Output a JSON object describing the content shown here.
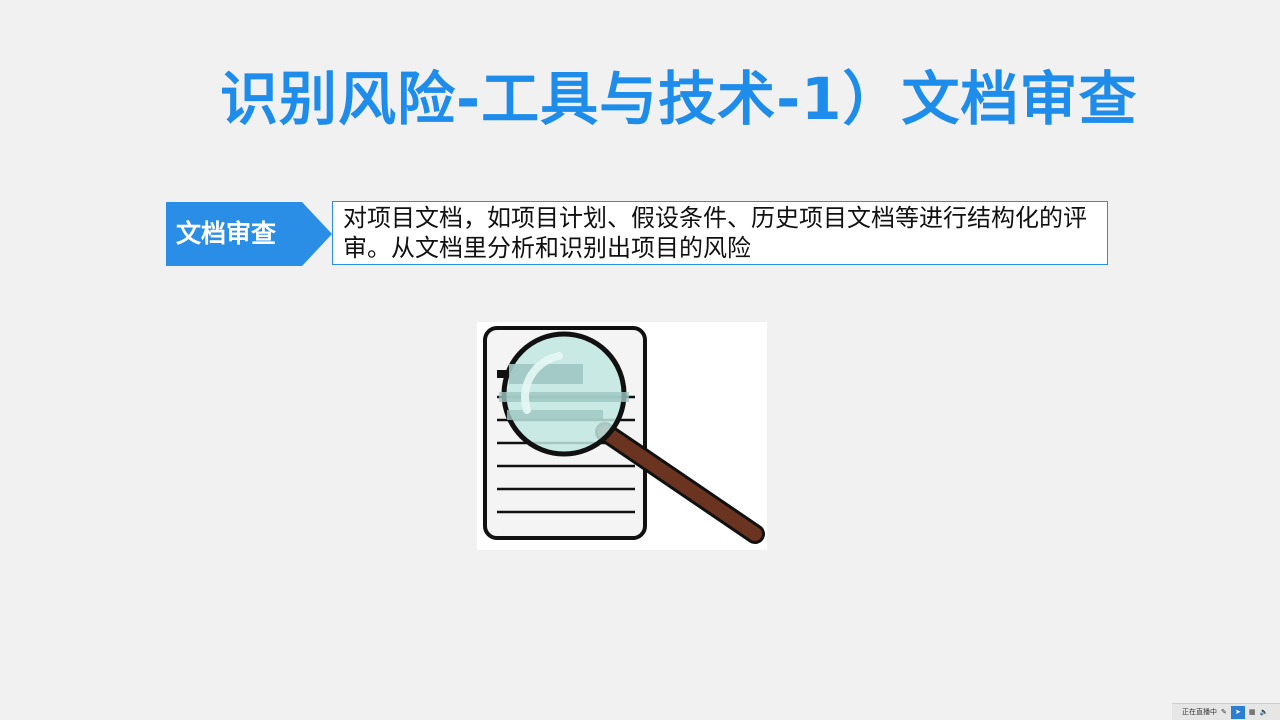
{
  "slide": {
    "title": "识别风险-工具与技术-1）文档审查",
    "tag_label": "文档审查",
    "description": "对项目文档，如项目计划、假设条件、历史项目文档等进行结构化的评审。从文档里分析和识别出项目的风险",
    "illustration_icon": "document-magnifier-icon"
  },
  "tray": {
    "live_text": "正在直播中",
    "icons": [
      "pen-icon",
      "cursor-icon",
      "screen-icon",
      "speaker-icon"
    ]
  },
  "colors": {
    "accent": "#1e8ceb",
    "tag_bg": "#2b8ee6",
    "background": "#f1f1f1"
  }
}
